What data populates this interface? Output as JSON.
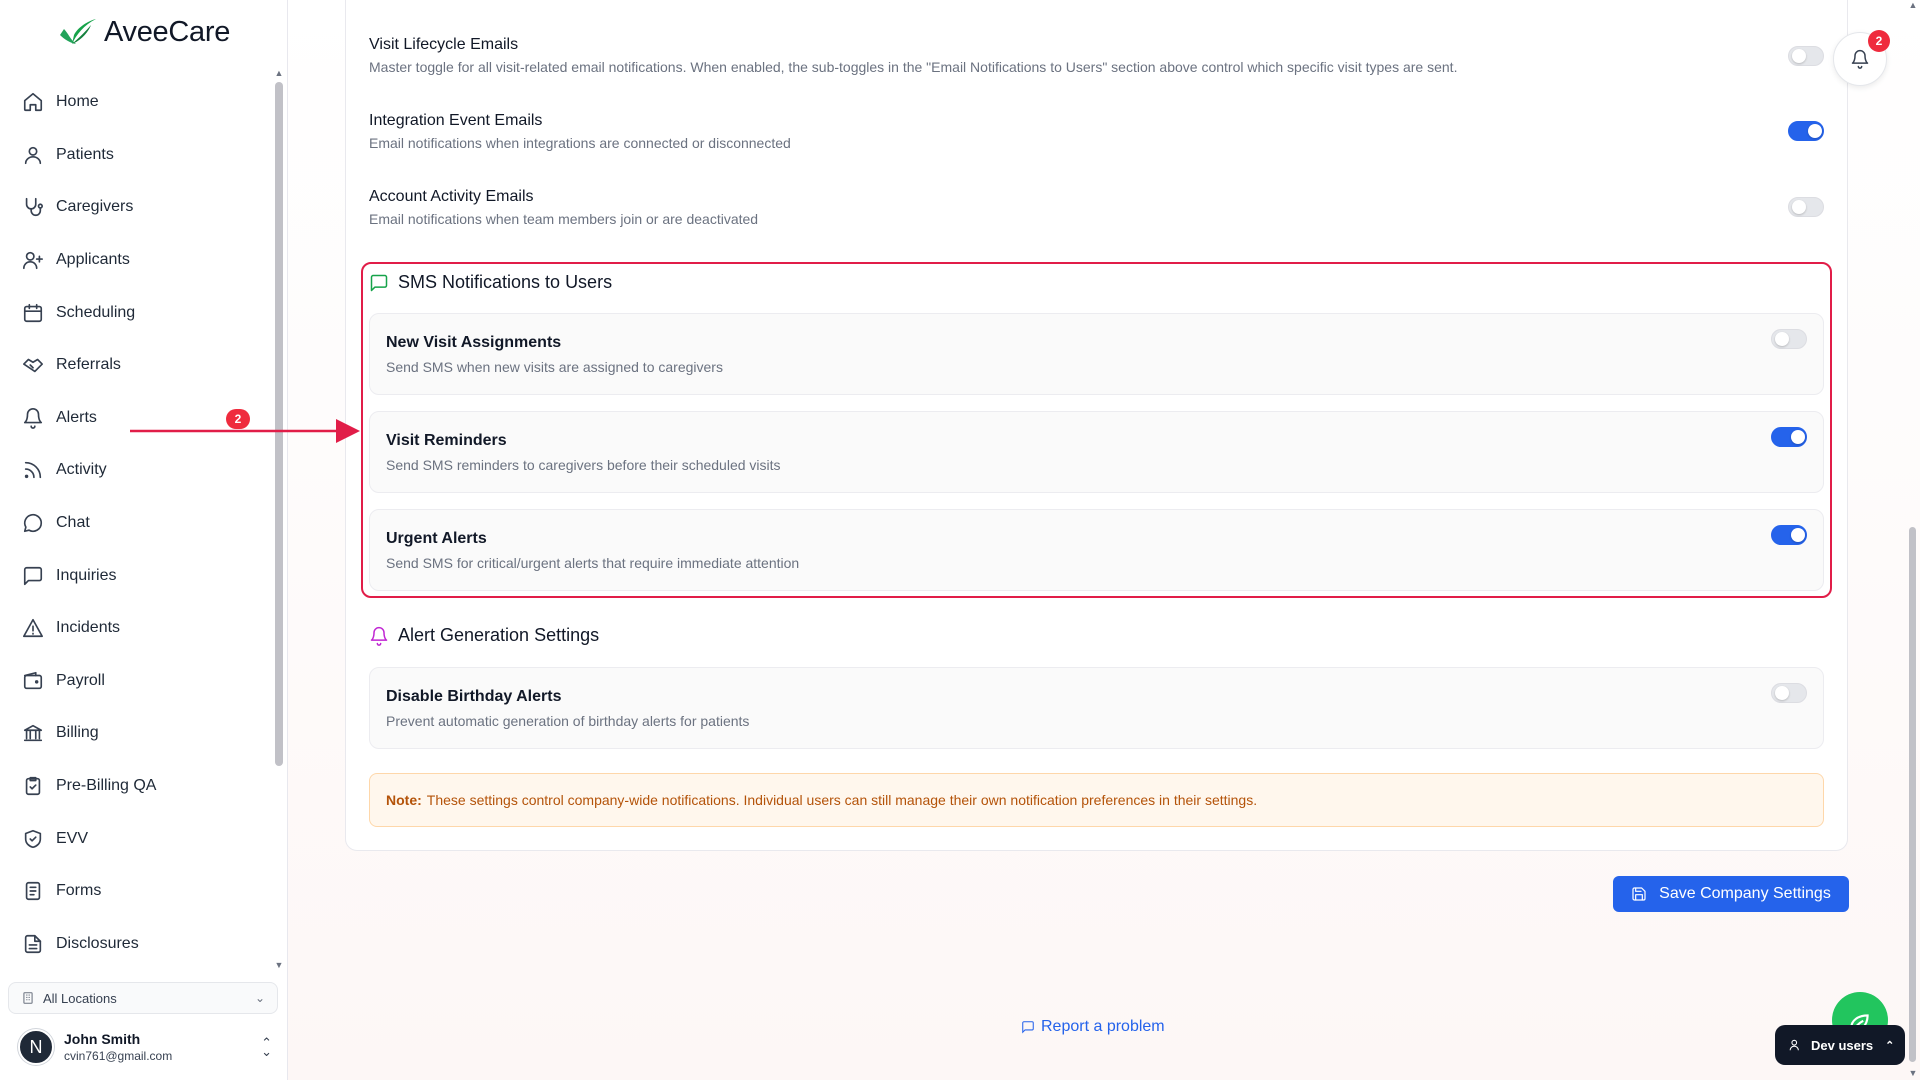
{
  "app": {
    "brand": "AveeCare"
  },
  "sidebar": {
    "items": [
      {
        "label": "Home",
        "icon": "home-icon"
      },
      {
        "label": "Patients",
        "icon": "user-icon"
      },
      {
        "label": "Caregivers",
        "icon": "stethoscope-icon"
      },
      {
        "label": "Applicants",
        "icon": "user-plus-icon"
      },
      {
        "label": "Scheduling",
        "icon": "calendar-icon"
      },
      {
        "label": "Referrals",
        "icon": "handshake-icon"
      },
      {
        "label": "Alerts",
        "icon": "bell-icon",
        "badge": "2"
      },
      {
        "label": "Activity",
        "icon": "rss-icon"
      },
      {
        "label": "Chat",
        "icon": "chat-icon"
      },
      {
        "label": "Inquiries",
        "icon": "message-square-icon"
      },
      {
        "label": "Incidents",
        "icon": "warning-icon"
      },
      {
        "label": "Payroll",
        "icon": "wallet-icon"
      },
      {
        "label": "Billing",
        "icon": "bank-icon"
      },
      {
        "label": "Pre-Billing QA",
        "icon": "clipboard-check-icon"
      },
      {
        "label": "EVV",
        "icon": "shield-check-icon"
      },
      {
        "label": "Forms",
        "icon": "form-icon"
      },
      {
        "label": "Disclosures",
        "icon": "document-icon"
      }
    ],
    "location": "All Locations",
    "user": {
      "initial": "N",
      "name": "John Smith",
      "email": "cvin761@gmail.com"
    }
  },
  "email_settings": [
    {
      "title": "Visit Lifecycle Emails",
      "desc": "Master toggle for all visit-related email notifications. When enabled, the sub-toggles in the \"Email Notifications to Users\" section above control which specific visit types are sent.",
      "enabled": false
    },
    {
      "title": "Integration Event Emails",
      "desc": "Email notifications when integrations are connected or disconnected",
      "enabled": true
    },
    {
      "title": "Account Activity Emails",
      "desc": "Email notifications when team members join or are deactivated",
      "enabled": false
    }
  ],
  "sms_section": {
    "title": "SMS Notifications to Users",
    "items": [
      {
        "title": "New Visit Assignments",
        "desc": "Send SMS when new visits are assigned to caregivers",
        "enabled": false
      },
      {
        "title": "Visit Reminders",
        "desc": "Send SMS reminders to caregivers before their scheduled visits",
        "enabled": true
      },
      {
        "title": "Urgent Alerts",
        "desc": "Send SMS for critical/urgent alerts that require immediate attention",
        "enabled": true
      }
    ]
  },
  "alert_section": {
    "title": "Alert Generation Settings",
    "items": [
      {
        "title": "Disable Birthday Alerts",
        "desc": "Prevent automatic generation of birthday alerts for patients",
        "enabled": false
      }
    ]
  },
  "note": {
    "label": "Note:",
    "text": "These settings control company-wide notifications. Individual users can still manage their own notification preferences in their settings."
  },
  "save_label": "Save Company Settings",
  "report_label": "Report a problem",
  "notifications": {
    "badge": "2"
  },
  "dev_users_label": "Dev users",
  "colors": {
    "accent": "#2563eb",
    "highlight": "#e11d48",
    "brand_green": "#22c55e",
    "badge_red": "#ef2b3d"
  }
}
